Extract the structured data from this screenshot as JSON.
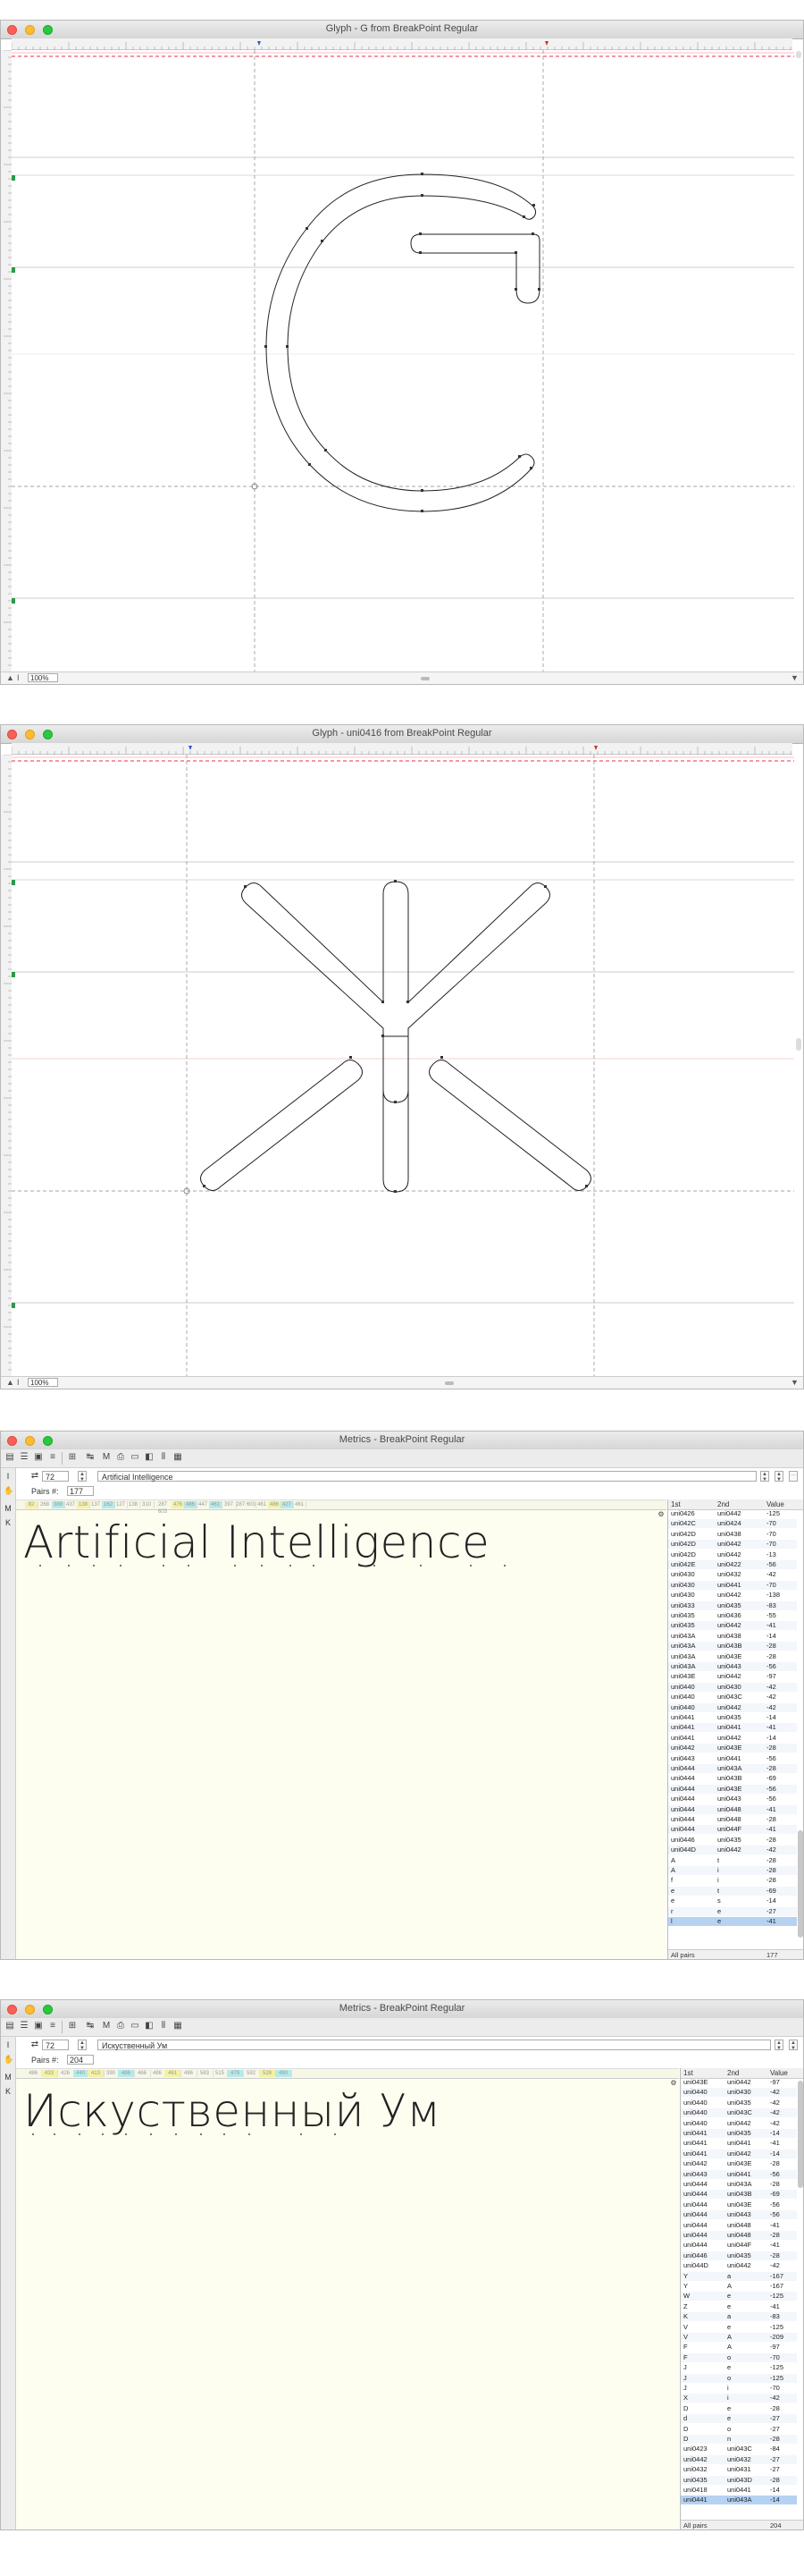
{
  "glyph_window_1": {
    "title": "Glyph - G from BreakPoint Regular",
    "zoom": "100%"
  },
  "glyph_window_2": {
    "title": "Glyph - uni0416 from BreakPoint Regular",
    "zoom": "100%"
  },
  "metrics_window_1": {
    "title": "Metrics - BreakPoint Regular",
    "size": "72",
    "text": "Artificial Intelligence",
    "pairs_label": "Pairs #:",
    "pairs_count": "177",
    "sample": "Artificial Intelligence",
    "columns": [
      "1st",
      "2nd",
      "Value"
    ],
    "rows": [
      [
        "uni0426",
        "uni0442",
        "-125"
      ],
      [
        "uni042C",
        "uni0424",
        "-70"
      ],
      [
        "uni042D",
        "uni0438",
        "-70"
      ],
      [
        "uni042D",
        "uni0442",
        "-70"
      ],
      [
        "uni042D",
        "uni0442",
        "-13"
      ],
      [
        "uni042E",
        "uni0422",
        "-56"
      ],
      [
        "uni0430",
        "uni0432",
        "-42"
      ],
      [
        "uni0430",
        "uni0441",
        "-70"
      ],
      [
        "uni0430",
        "uni0442",
        "-138"
      ],
      [
        "uni0433",
        "uni0435",
        "-83"
      ],
      [
        "uni0435",
        "uni0436",
        "-55"
      ],
      [
        "uni0435",
        "uni0442",
        "-41"
      ],
      [
        "uni043A",
        "uni0438",
        "-14"
      ],
      [
        "uni043A",
        "uni043B",
        "-28"
      ],
      [
        "uni043A",
        "uni043E",
        "-28"
      ],
      [
        "uni043A",
        "uni0443",
        "-56"
      ],
      [
        "uni043E",
        "uni0442",
        "-97"
      ],
      [
        "uni0440",
        "uni0430",
        "-42"
      ],
      [
        "uni0440",
        "uni043C",
        "-42"
      ],
      [
        "uni0440",
        "uni0442",
        "-42"
      ],
      [
        "uni0441",
        "uni0435",
        "-14"
      ],
      [
        "uni0441",
        "uni0441",
        "-41"
      ],
      [
        "uni0441",
        "uni0442",
        "-14"
      ],
      [
        "uni0442",
        "uni043E",
        "-28"
      ],
      [
        "uni0443",
        "uni0441",
        "-56"
      ],
      [
        "uni0444",
        "uni043A",
        "-28"
      ],
      [
        "uni0444",
        "uni043B",
        "-69"
      ],
      [
        "uni0444",
        "uni043E",
        "-56"
      ],
      [
        "uni0444",
        "uni0443",
        "-56"
      ],
      [
        "uni0444",
        "uni0448",
        "-41"
      ],
      [
        "uni0444",
        "uni0448",
        "-28"
      ],
      [
        "uni0444",
        "uni044F",
        "-41"
      ],
      [
        "uni0446",
        "uni0435",
        "-28"
      ],
      [
        "uni044D",
        "uni0442",
        "-42"
      ],
      [
        "A",
        "t",
        "-28"
      ],
      [
        "A",
        "i",
        "-28"
      ],
      [
        "f",
        "i",
        "-28"
      ],
      [
        "e",
        "t",
        "-69"
      ],
      [
        "e",
        "s",
        "-14"
      ],
      [
        "r",
        "e",
        "-27"
      ],
      [
        "l",
        "e",
        "-41"
      ]
    ],
    "selected_row": 40,
    "footer_label": "All pairs",
    "footer_value": "177"
  },
  "metrics_window_2": {
    "title": "Metrics - BreakPoint Regular",
    "size": "72",
    "text": "Искуственный Ум",
    "pairs_label": "Pairs #:",
    "pairs_count": "204",
    "sample": "Искуственный Ум",
    "columns": [
      "1st",
      "2nd",
      "Value"
    ],
    "rows": [
      [
        "uni043E",
        "uni0442",
        "-97"
      ],
      [
        "uni0440",
        "uni0430",
        "-42"
      ],
      [
        "uni0440",
        "uni0435",
        "-42"
      ],
      [
        "uni0440",
        "uni043C",
        "-42"
      ],
      [
        "uni0440",
        "uni0442",
        "-42"
      ],
      [
        "uni0441",
        "uni0435",
        "-14"
      ],
      [
        "uni0441",
        "uni0441",
        "-41"
      ],
      [
        "uni0441",
        "uni0442",
        "-14"
      ],
      [
        "uni0442",
        "uni043E",
        "-28"
      ],
      [
        "uni0443",
        "uni0441",
        "-56"
      ],
      [
        "uni0444",
        "uni043A",
        "-28"
      ],
      [
        "uni0444",
        "uni043B",
        "-69"
      ],
      [
        "uni0444",
        "uni043E",
        "-56"
      ],
      [
        "uni0444",
        "uni0443",
        "-56"
      ],
      [
        "uni0444",
        "uni0448",
        "-41"
      ],
      [
        "uni0444",
        "uni0448",
        "-28"
      ],
      [
        "uni0444",
        "uni044F",
        "-41"
      ],
      [
        "uni0446",
        "uni0435",
        "-28"
      ],
      [
        "uni044D",
        "uni0442",
        "-42"
      ],
      [
        "Y",
        "a",
        "-167"
      ],
      [
        "Y",
        "A",
        "-167"
      ],
      [
        "W",
        "e",
        "-125"
      ],
      [
        "Z",
        "e",
        "-41"
      ],
      [
        "K",
        "a",
        "-83"
      ],
      [
        "V",
        "e",
        "-125"
      ],
      [
        "V",
        "A",
        "-209"
      ],
      [
        "F",
        "A",
        "-97"
      ],
      [
        "F",
        "o",
        "-70"
      ],
      [
        "J",
        "e",
        "-125"
      ],
      [
        "J",
        "o",
        "-125"
      ],
      [
        "J",
        "i",
        "-70"
      ],
      [
        "X",
        "i",
        "-42"
      ],
      [
        "D",
        "e",
        "-28"
      ],
      [
        "d",
        "e",
        "-27"
      ],
      [
        "D",
        "o",
        "-27"
      ],
      [
        "D",
        "n",
        "-28"
      ],
      [
        "uni0423",
        "uni043C",
        "-84"
      ],
      [
        "uni0442",
        "uni0432",
        "-27"
      ],
      [
        "uni0432",
        "uni0431",
        "-27"
      ],
      [
        "uni0435",
        "uni043D",
        "-28"
      ],
      [
        "uni0418",
        "uni0441",
        "-14"
      ],
      [
        "uni0441",
        "uni043A",
        "-14"
      ]
    ],
    "selected_row": 41,
    "footer_label": "All pairs",
    "footer_value": "204"
  }
}
